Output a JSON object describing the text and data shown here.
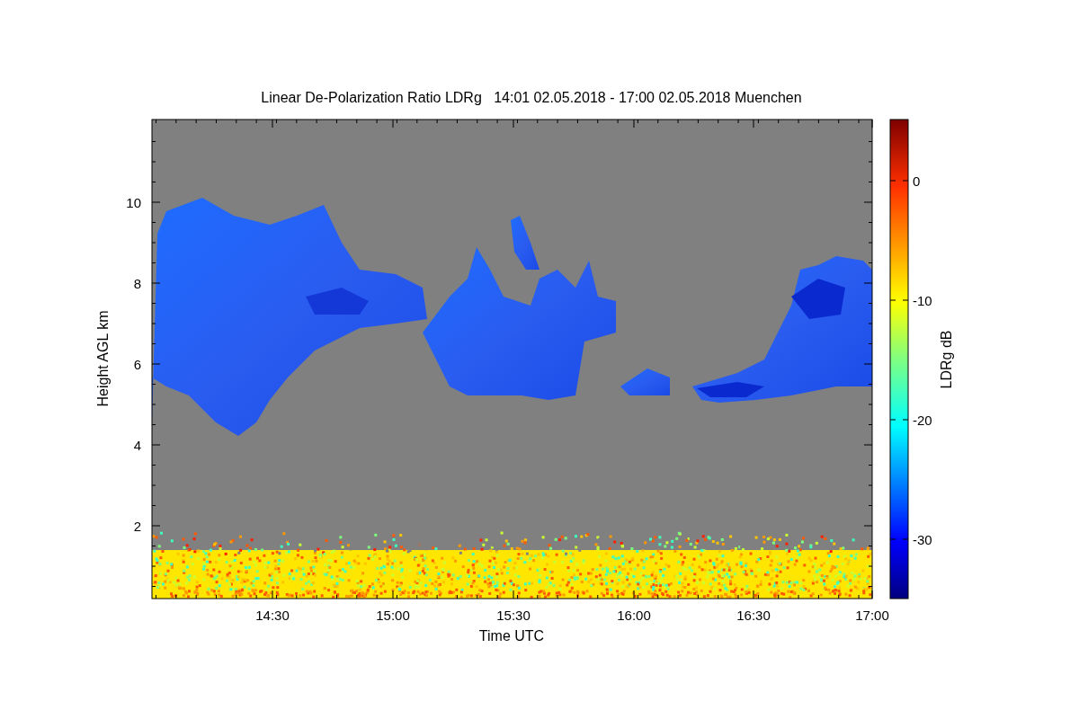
{
  "chart": {
    "title": "Linear De-Polarization Ratio LDRg   14:01 02.05.2018 - 17:00 02.05.2018 Muenchen",
    "xlabel": "Time UTC",
    "ylabel": "Height AGL km",
    "xticks": [
      "14:30",
      "15:00",
      "15:30",
      "16:00",
      "16:30",
      "17:00"
    ],
    "yticks": [
      "10",
      "8",
      "6",
      "4",
      "2"
    ],
    "colorbar": {
      "label": "LDRg dB",
      "ticks": [
        "0",
        "-10",
        "-20",
        "-30"
      ]
    }
  }
}
